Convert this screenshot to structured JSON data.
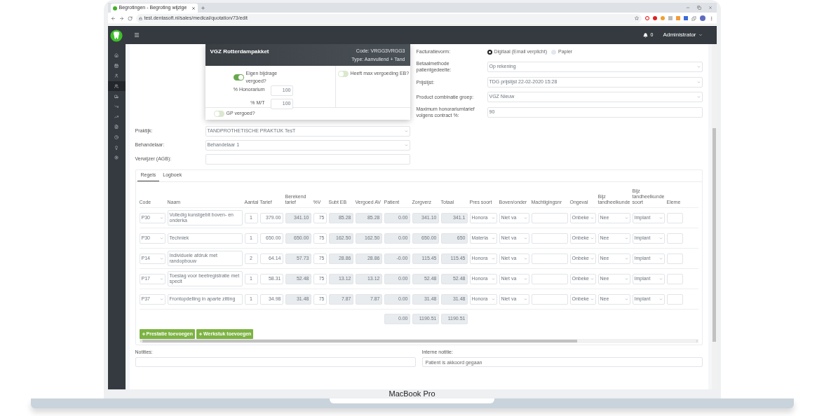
{
  "browser": {
    "tab_title": "Begrotingen - Begroting wijzige",
    "address": "test.dentasoft.nl/sales/medical/quotation/73/edit"
  },
  "navbar": {
    "notifications": "0",
    "user": "Administrator"
  },
  "sidebar": {
    "items": [
      {
        "selected": false
      },
      {
        "selected": false
      },
      {
        "selected": false
      },
      {
        "selected": true
      },
      {
        "selected": false
      },
      {
        "selected": false
      },
      {
        "selected": false
      },
      {
        "selected": false
      },
      {
        "selected": false
      },
      {
        "selected": false
      },
      {
        "selected": false
      }
    ]
  },
  "package_card": {
    "title": "VGZ Rotterdampakket",
    "code": "Code: VRGG3VRGG3",
    "type": "Type: Aanvullend + Tand",
    "toggles": [
      {
        "label": "Eigen bijdrage vergoed?",
        "on": true
      },
      {
        "label": "Heeft max vergoeding EB?",
        "on": false
      },
      {
        "label": "GP vergoed?",
        "on": false
      }
    ],
    "fields": [
      {
        "label": "% Honorarium",
        "value": "100"
      },
      {
        "label": "% M/T",
        "value": "100"
      }
    ]
  },
  "left_form": [
    {
      "label": "Praktijk:",
      "kind": "select",
      "value": "TANDPROTHETISCHE PRAKTIJK TesT"
    },
    {
      "label": "Behandelaar:",
      "kind": "select",
      "value": "Behandelaar 1"
    },
    {
      "label": "Verwijzer (AGB):",
      "kind": "input"
    }
  ],
  "right_form": {
    "invoice_form": {
      "label": "Facturatievorm:",
      "options": [
        {
          "label": "Digitaal (Email verplicht)",
          "selected": true
        },
        {
          "label": "Papier",
          "selected": false
        }
      ]
    },
    "fields": [
      {
        "label": "Betaalmethode patientgedeelte:",
        "kind": "select",
        "value": "Op rekening"
      },
      {
        "label": "Prijslijst:",
        "kind": "select",
        "value": "TDG prijslijst 22-02-2020 15:28"
      },
      {
        "label": "Product combinatie groep:",
        "kind": "select",
        "value": "VGZ Nieuw"
      },
      {
        "label": "Maximum honorariumtarief volgens contract %:",
        "kind": "input",
        "value": "90"
      }
    ]
  },
  "tabs": [
    {
      "label": "Regels",
      "selected": true
    },
    {
      "label": "Logboek",
      "selected": false
    }
  ],
  "table": {
    "columns": [
      {
        "label": "Code",
        "kind": "select"
      },
      {
        "label": "Naam",
        "kind": "text"
      },
      {
        "label": "Aantal",
        "kind": "input_center"
      },
      {
        "label": "Tarief",
        "kind": "input"
      },
      {
        "label": "Berekend tarief",
        "kind": "readonly"
      },
      {
        "label": "%V",
        "kind": "input"
      },
      {
        "label": "Subt EB",
        "kind": "readonly"
      },
      {
        "label": "Vergoed AV",
        "kind": "readonly"
      },
      {
        "label": "Patient",
        "kind": "readonly",
        "total": "0.00"
      },
      {
        "label": "Zorgverz",
        "kind": "readonly",
        "total": "1190.51"
      },
      {
        "label": "Totaal",
        "kind": "readonly",
        "total": "1190.51"
      },
      {
        "label": "Pres soort",
        "kind": "select"
      },
      {
        "label": "Boven/onder",
        "kind": "select"
      },
      {
        "label": "Machtigingsnr",
        "kind": "input"
      },
      {
        "label": "Ongeval",
        "kind": "select"
      },
      {
        "label": "Bijz tandheelkunde",
        "kind": "select"
      },
      {
        "label": "Bijz tandheelkunde soort",
        "kind": "select"
      },
      {
        "label": "Eleme",
        "kind": "input"
      }
    ],
    "rows": [
      {
        "cells": [
          "P30",
          "Volledig kunstgebit boven- en onderka",
          "1",
          "379.00",
          "341.10",
          "75",
          "85.28",
          "85.28",
          "0.00",
          "341.10",
          "341.1",
          "Honora",
          "Niet va",
          "",
          "Onbeke",
          "Nee",
          "Implant",
          ""
        ]
      },
      {
        "cells": [
          "P30",
          "Techniek",
          "1",
          "650.00",
          "650.00",
          "75",
          "162.50",
          "162.50",
          "0.00",
          "650.00",
          "650",
          "Materia",
          "Niet va",
          "",
          "Onbeke",
          "Nee",
          "Implant",
          ""
        ]
      },
      {
        "cells": [
          "P14",
          "Individuele afdruk met randopbouw",
          "2",
          "64.14",
          "57.73",
          "75",
          "28.86",
          "28.86",
          "-0.00",
          "115.45",
          "115.45",
          "Honora",
          "Niet va",
          "",
          "Onbeke",
          "Nee",
          "Implant",
          ""
        ]
      },
      {
        "cells": [
          "P17",
          "Toeslag voor beetregistratie met specit",
          "1",
          "58.31",
          "52.48",
          "75",
          "13.12",
          "13.12",
          "0.00",
          "52.48",
          "52.48",
          "Honora",
          "Niet va",
          "",
          "Onbeke",
          "Nee",
          "Implant",
          ""
        ]
      },
      {
        "cells": [
          "P37",
          "Frontopdelling in aparte zitting",
          "1",
          "34.98",
          "31.48",
          "75",
          "7.87",
          "7.87",
          "0.00",
          "31.48",
          "31.48",
          "Honora",
          "Niet va",
          "",
          "Onbeke",
          "Nee",
          "Implant",
          ""
        ]
      }
    ]
  },
  "buttons": [
    {
      "label": "Prestatie toevoegen"
    },
    {
      "label": "Werkstuk toevoegen"
    }
  ],
  "notes": [
    {
      "label": "Notities:"
    },
    {
      "label": "Interne notitie:",
      "value": "Patient is akkoord gegaan"
    }
  ],
  "device": {
    "label": "MacBook Pro"
  }
}
